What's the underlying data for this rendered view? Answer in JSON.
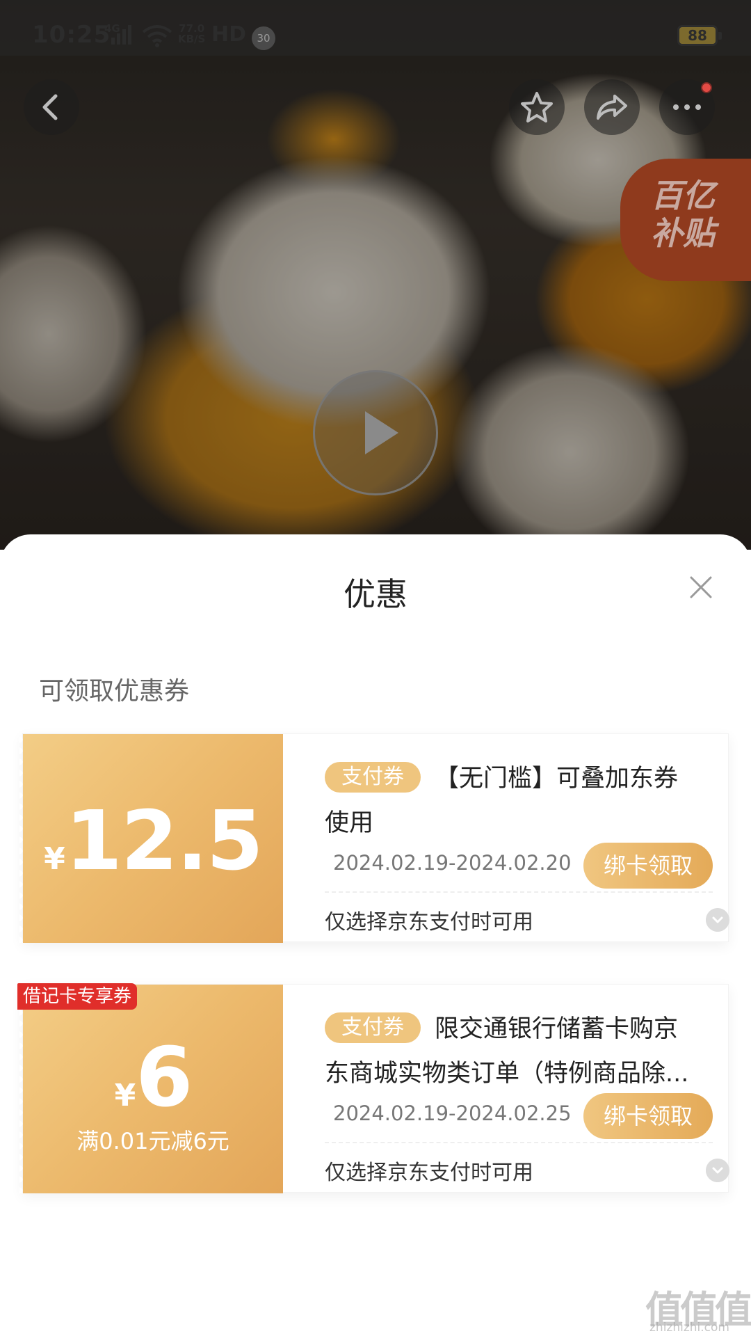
{
  "status_bar": {
    "time": "10:25",
    "network": "4G",
    "speed_value": "77.0",
    "speed_unit": "KB/S",
    "hd": "HD",
    "badge": "30",
    "battery": "88"
  },
  "hero": {
    "subsidy_line1": "百亿",
    "subsidy_line2": "补贴",
    "icons": [
      "back-icon",
      "star-icon",
      "share-icon",
      "more-icon",
      "play-icon"
    ]
  },
  "sheet": {
    "title": "优惠",
    "section_title": "可领取优惠券",
    "coupons": [
      {
        "currency": "¥",
        "amount": "12.5",
        "condition": "",
        "exclusive_label": "",
        "tag": "支付券",
        "description": "【无门槛】可叠加东券使用",
        "dates": "2024.02.19-2024.02.20",
        "button": "绑卡领取",
        "note": "仅选择京东支付时可用"
      },
      {
        "currency": "¥",
        "amount": "6",
        "condition": "满0.01元减6元",
        "exclusive_label": "借记卡专享券",
        "tag": "支付券",
        "description": "限交通银行储蓄卡购京东商城实物类订单（特例商品除...",
        "dates": "2024.02.19-2024.02.25",
        "button": "绑卡领取",
        "note": "仅选择京东支付时可用"
      }
    ]
  },
  "watermark": {
    "text": "值值值",
    "url": "zhizhizhi.com"
  },
  "colors": {
    "coupon_gold": "#ecb96c",
    "tag_gold": "#efc57e",
    "exclusive_red": "#e02e2a"
  }
}
